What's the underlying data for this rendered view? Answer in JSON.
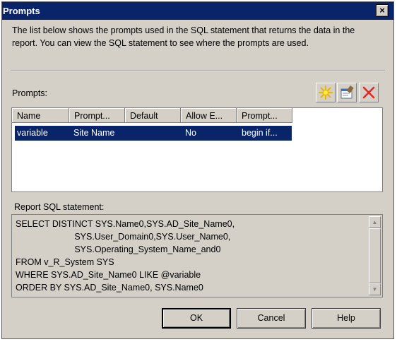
{
  "window": {
    "title": "Prompts",
    "close_label": "×"
  },
  "description": "The list below shows the prompts used in the SQL statement that returns the data in the report. You can view the SQL statement to see where the prompts are used.",
  "prompts": {
    "label": "Prompts:",
    "toolbar": {
      "new_icon": "new-star-icon",
      "edit_icon": "properties-icon",
      "delete_icon": "delete-x-icon"
    },
    "columns": [
      "Name",
      "Prompt...",
      "Default",
      "Allow E...",
      "Prompt..."
    ],
    "rows": [
      {
        "name": "variable",
        "prompt_text": "Site Name",
        "default": "",
        "allow": "No",
        "prompt_query": "begin if..."
      }
    ]
  },
  "sql": {
    "label": "Report SQL statement:",
    "text": "SELECT DISTINCT SYS.Name0,SYS.AD_Site_Name0,\n                        SYS.User_Domain0,SYS.User_Name0,\n                        SYS.Operating_System_Name_and0\nFROM v_R_System SYS\nWHERE SYS.AD_Site_Name0 LIKE @variable\nORDER BY SYS.AD_Site_Name0, SYS.Name0"
  },
  "buttons": {
    "ok": "OK",
    "cancel": "Cancel",
    "help": "Help"
  },
  "colors": {
    "titlebar": "#0a246a",
    "selection": "#0a246a",
    "face": "#d4d0c8"
  }
}
